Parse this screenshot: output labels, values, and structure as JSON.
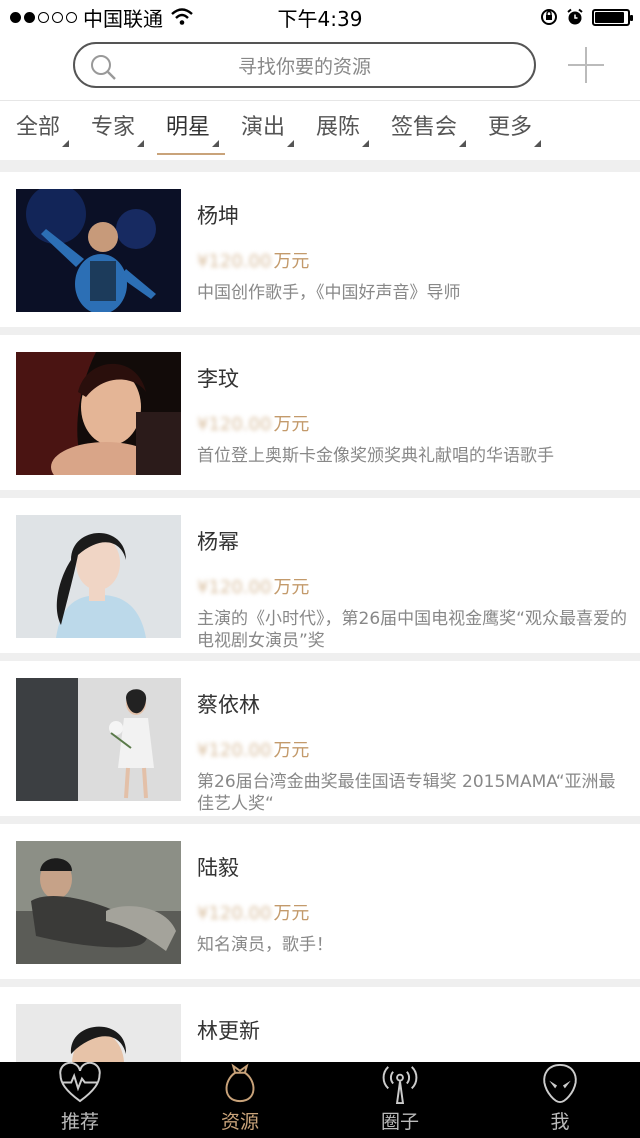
{
  "status_bar": {
    "carrier": "中国联通",
    "time": "下午4:39",
    "battery_level": 0.9
  },
  "search": {
    "placeholder": "寻找你要的资源"
  },
  "tabs": [
    {
      "label": "全部"
    },
    {
      "label": "专家"
    },
    {
      "label": "明星"
    },
    {
      "label": "演出"
    },
    {
      "label": "展陈"
    },
    {
      "label": "签售会"
    },
    {
      "label": "更多"
    }
  ],
  "active_tab": "明星",
  "items": [
    {
      "name": "杨坤",
      "price": "¥120.00",
      "price_unit": "万元",
      "desc": "中国创作歌手，《中国好声音》导师"
    },
    {
      "name": "李玟",
      "price": "¥120.00",
      "price_unit": "万元",
      "desc": "首位登上奥斯卡金像奖颁奖典礼献唱的华语歌手"
    },
    {
      "name": "杨幂",
      "price": "¥120.00",
      "price_unit": "万元",
      "desc": "主演的《小时代》，第26届中国电视金鹰奖“观众最喜爱的电视剧女演员”奖"
    },
    {
      "name": "蔡依林",
      "price": "¥120.00",
      "price_unit": "万元",
      "desc": "第26届台湾金曲奖最佳国语专辑奖 2015MAMA“亚洲最佳艺人奖“"
    },
    {
      "name": "陆毅",
      "price": "¥120.00",
      "price_unit": "万元",
      "desc": "知名演员，歌手！"
    },
    {
      "name": "林更新",
      "price": "",
      "price_unit": "",
      "desc": ""
    }
  ],
  "tabbar": [
    {
      "label": "推荐",
      "icon": "heart-pulse-icon"
    },
    {
      "label": "资源",
      "icon": "money-bag-icon"
    },
    {
      "label": "圈子",
      "icon": "broadcast-icon"
    },
    {
      "label": "我",
      "icon": "alien-icon"
    }
  ],
  "colors": {
    "accent": "#c9a37a",
    "tabbar_bg": "#000000"
  }
}
